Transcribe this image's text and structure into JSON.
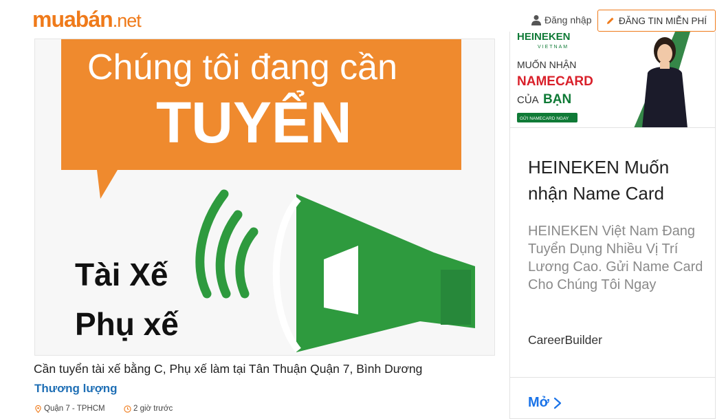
{
  "header": {
    "logo_main": "muabán",
    "logo_suffix": ".net",
    "login_label": "Đăng nhập",
    "post_button_label": "ĐĂNG TIN MIỄN PHÍ"
  },
  "listing": {
    "image_text": {
      "line1": "Chúng tôi đang cần",
      "line2": "TUYỂN",
      "line3": "Tài Xế",
      "line4": "Phụ xế"
    },
    "title": "Cần tuyển tài xế bằng C, Phụ xế làm tại Tân Thuận Quận 7, Bình Dương",
    "price": "Thương lượng",
    "location": "Quận 7 - TPHCM",
    "posted": "2 giờ trước"
  },
  "ad": {
    "banner": {
      "brand": "HEINEKEN",
      "brand_sub": "VIETNAM",
      "line1": "MUỐN NHẬN",
      "line2": "NAMECARD",
      "line3_prefix": "CỦA",
      "line3_bold": "BẠN",
      "cta": "GỬI NAMECARD NGAY"
    },
    "title": "HEINEKEN Muốn nhận Name Card",
    "description": "HEINEKEN Việt Nam Đang Tuyển Dụng Nhiều Vị Trí Lương Cao. Gửi Name Card Cho Chúng Tôi Ngay",
    "source": "CareerBuilder",
    "open_label": "Mở"
  },
  "colors": {
    "brand_orange": "#ef7a1a",
    "price_blue": "#1f6fb5",
    "heineken_green": "#0f7a36",
    "ad_red": "#d9202a",
    "link_blue": "#1a73e8"
  }
}
